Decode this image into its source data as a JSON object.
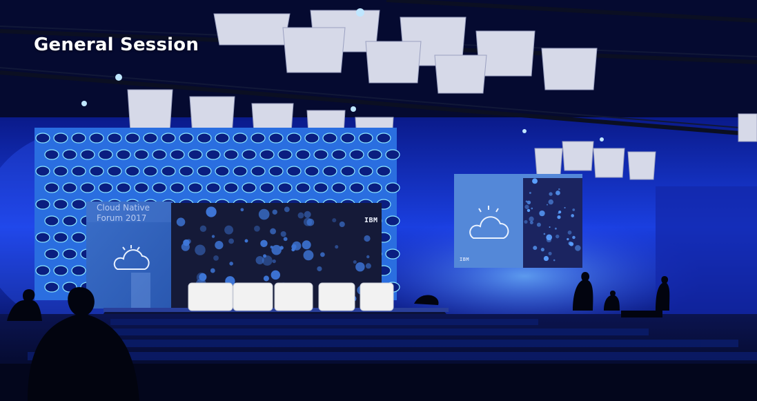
{
  "header": {
    "title": "General Session"
  },
  "stage": {
    "left_screen_text": "Cloud Native\nForum 2017",
    "logo_text": "IBM",
    "right_screen_logo": "IBM"
  },
  "colors": {
    "ambient_blue": "#1630c8",
    "deep_blue": "#04082a",
    "cyan_light": "#7fe7ff",
    "chair_white": "#f2f2f2"
  }
}
